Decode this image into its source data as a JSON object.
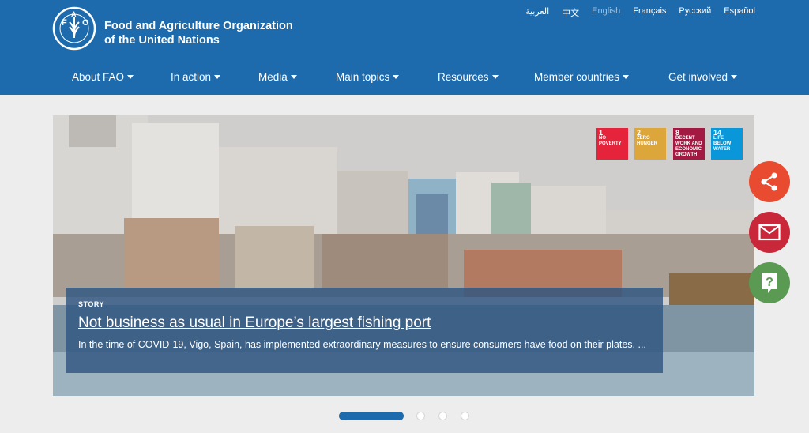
{
  "header": {
    "org_name_line1": "Food and Agriculture Organization",
    "org_name_line2": "of the United Nations",
    "logo_text": "FAO",
    "logo_motto": "FIAT PANIS",
    "brand_color": "#1d6aac"
  },
  "languages": [
    {
      "label": "العربية",
      "active": false
    },
    {
      "label": "中文",
      "active": false
    },
    {
      "label": "English",
      "active": true
    },
    {
      "label": "Français",
      "active": false
    },
    {
      "label": "Русский",
      "active": false
    },
    {
      "label": "Español",
      "active": false
    }
  ],
  "nav": [
    {
      "label": "About FAO"
    },
    {
      "label": "In action"
    },
    {
      "label": "Media"
    },
    {
      "label": "Main topics"
    },
    {
      "label": "Resources"
    },
    {
      "label": "Member countries"
    },
    {
      "label": "Get involved"
    }
  ],
  "hero": {
    "tag": "STORY",
    "title": "Not business as usual in Europe’s largest fishing port",
    "description": "In the time of COVID-19, Vigo, Spain, has implemented extraordinary measures to ensure consumers have food on their plates. ...",
    "sdgs": [
      {
        "num": "1",
        "label": "NO POVERTY",
        "color": "#e5243b"
      },
      {
        "num": "2",
        "label": "ZERO HUNGER",
        "color": "#dda63a"
      },
      {
        "num": "8",
        "label": "DECENT WORK AND ECONOMIC GROWTH",
        "color": "#a21942"
      },
      {
        "num": "14",
        "label": "LIFE BELOW WATER",
        "color": "#0a97d9"
      }
    ]
  },
  "carousel": {
    "total_slides": 4,
    "active_slide": 1
  },
  "floating_buttons": [
    {
      "icon": "share-icon",
      "color": "#e84b2f"
    },
    {
      "icon": "mail-icon",
      "color": "#c8283a"
    },
    {
      "icon": "question-icon",
      "color": "#5a9a53"
    }
  ]
}
